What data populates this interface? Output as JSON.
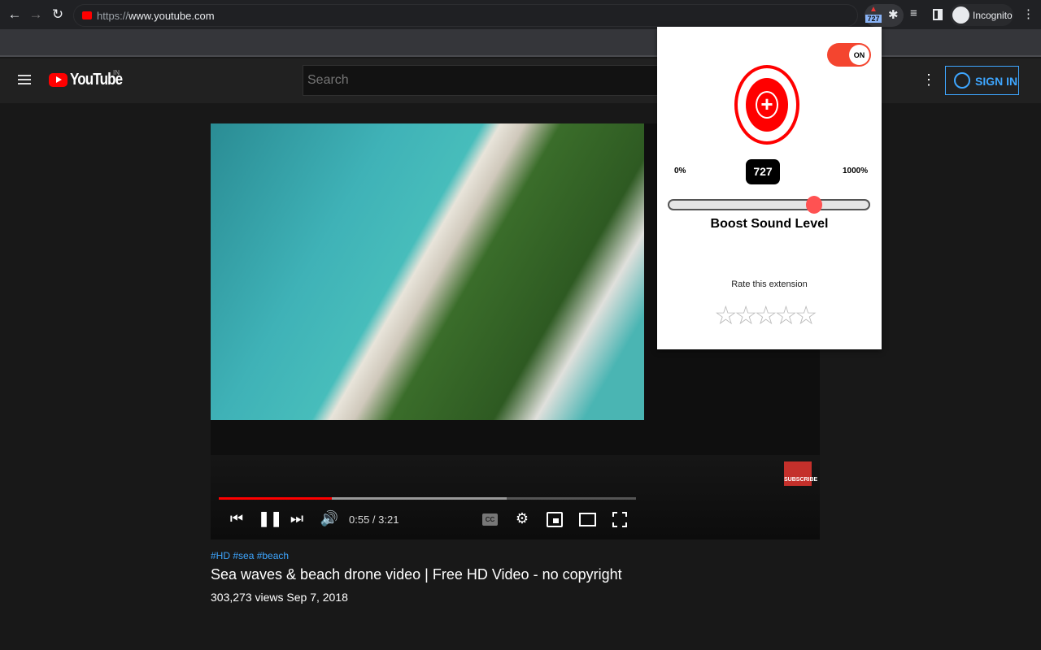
{
  "browser": {
    "url_scheme": "https://",
    "url_host": "www.youtube.com",
    "extension_badge": "727",
    "profile_label": "Incognito"
  },
  "youtube": {
    "logo_text": "YouTube",
    "region": "IN",
    "search_placeholder": "Search",
    "sign_in": "SIGN IN"
  },
  "player": {
    "time": "0:55 / 3:21",
    "played_fraction": 0.27,
    "buffered_fraction": 0.69,
    "subscribe_watermark": "SUBSCRIBE"
  },
  "video": {
    "hashtags": "#HD #sea #beach",
    "title": "Sea waves & beach drone video | Free HD Video - no copyright",
    "stats": "303,273 views  Sep 7, 2018"
  },
  "extension": {
    "toggle_label": "ON",
    "min_label": "0%",
    "max_label": "1000%",
    "value": "727",
    "slider_fraction": 0.727,
    "heading": "Boost Sound Level",
    "rate_label": "Rate this extension",
    "stars": 5,
    "accent": "#ff3b30"
  }
}
